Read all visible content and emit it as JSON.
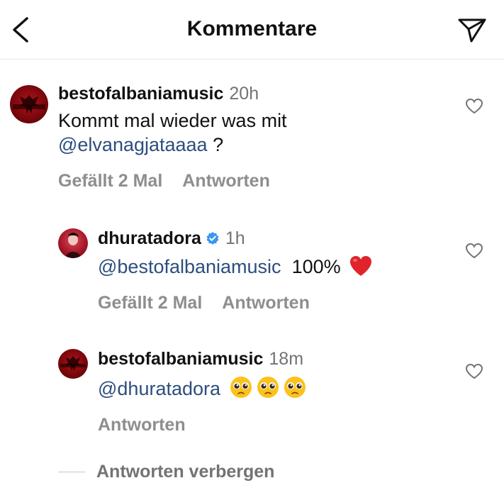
{
  "header": {
    "title": "Kommentare"
  },
  "comments": [
    {
      "username": "bestofalbaniamusic",
      "time": "20h",
      "text_line1": "Kommt mal wieder was mit",
      "mention": "@elvanagjataaaa",
      "text_after_mention": " ?",
      "likes": "Gefällt 2 Mal",
      "reply": "Antworten",
      "avatar_text": "ALBANIAN MUSIC"
    },
    {
      "username": "dhuratadora",
      "time": "1h",
      "mention": "@bestofalbaniamusic",
      "text_after_mention": "100%",
      "likes": "Gefällt 2 Mal",
      "reply": "Antworten",
      "verified": true
    },
    {
      "username": "bestofalbaniamusic",
      "time": "18m",
      "mention": "@dhuratadora",
      "reply": "Antworten",
      "avatar_text": "ALBANIAN MUSIC"
    }
  ],
  "hide_replies": "Antworten verbergen",
  "colors": {
    "mention": "#2d4e7e",
    "meta": "#8e8e8e",
    "verified": "#3897f0",
    "heart_emoji": "#e0242b"
  },
  "icons": [
    "back-arrow-icon",
    "send-icon",
    "heart-outline-icon",
    "verified-badge-icon",
    "red-heart-emoji",
    "pleading-face-emoji"
  ]
}
